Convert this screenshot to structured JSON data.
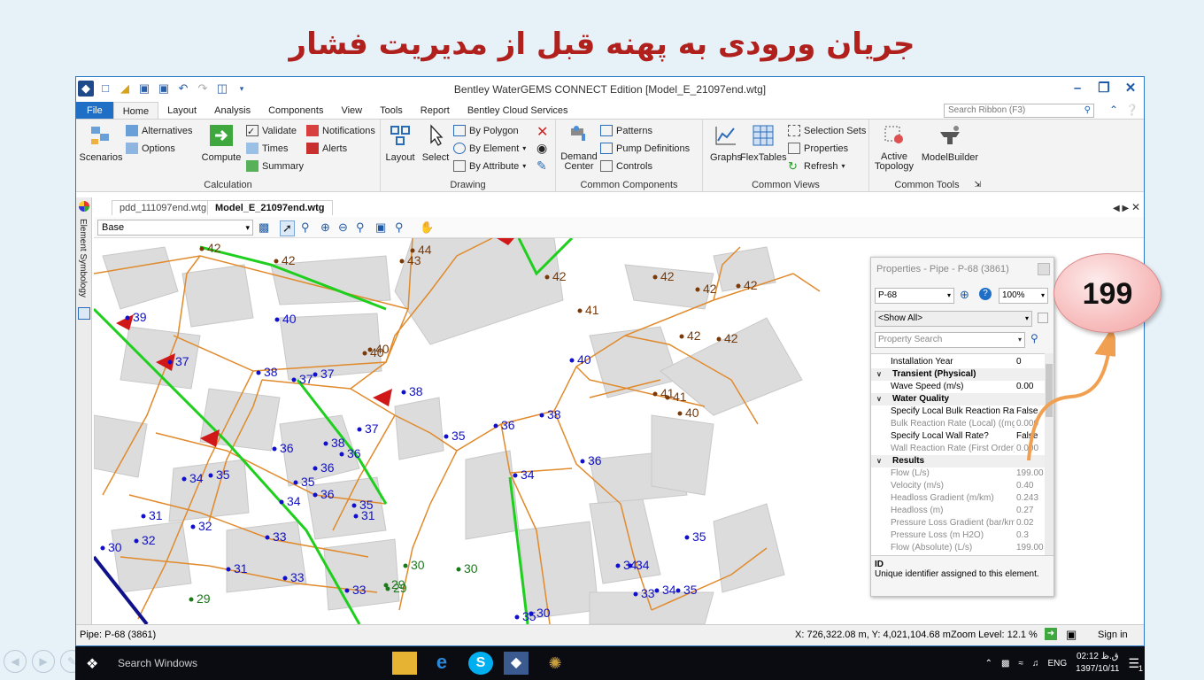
{
  "slide_title": "جریان ورودی به پهنه قبل از مدیریت فشار",
  "window": {
    "title": "Bentley WaterGEMS CONNECT Edition [Model_E_21097end.wtg]"
  },
  "ribbon_tabs": [
    "File",
    "Home",
    "Layout",
    "Analysis",
    "Components",
    "View",
    "Tools",
    "Report",
    "Bentley Cloud Services"
  ],
  "search_ribbon_placeholder": "Search Ribbon (F3)",
  "ribbon": {
    "calculation": {
      "label": "Calculation",
      "scenarios": "Scenarios",
      "alternatives": "Alternatives",
      "options": "Options",
      "compute": "Compute",
      "validate": "Validate",
      "times": "Times",
      "summary": "Summary",
      "notifications": "Notifications",
      "alerts": "Alerts"
    },
    "drawing": {
      "label": "Drawing",
      "layout": "Layout",
      "select": "Select",
      "by_polygon": "By Polygon",
      "by_element": "By Element",
      "by_attribute": "By Attribute"
    },
    "common_components": {
      "label": "Common Components",
      "demand_center": "Demand Center",
      "patterns": "Patterns",
      "pump_definitions": "Pump Definitions",
      "controls": "Controls"
    },
    "common_views": {
      "label": "Common Views",
      "graphs": "Graphs",
      "flextables": "FlexTables",
      "selection_sets": "Selection Sets",
      "properties": "Properties",
      "refresh": "Refresh"
    },
    "common_tools": {
      "label": "Common Tools",
      "active_topology": "Active Topology",
      "modelbuilder": "ModelBuilder"
    }
  },
  "doc_tabs": [
    "pdd_111097end.wtg",
    "Model_E_21097end.wtg"
  ],
  "side_panel_label": "Element Symbology",
  "layer_select": "Base",
  "map_labels": [
    {
      "t": "42",
      "c": "brown"
    },
    {
      "t": "44",
      "c": "brown"
    },
    {
      "t": "42",
      "c": "brown"
    },
    {
      "t": "43",
      "c": "brown"
    },
    {
      "t": "42",
      "c": "brown"
    },
    {
      "t": "42",
      "c": "brown"
    },
    {
      "t": "42",
      "c": "brown"
    },
    {
      "t": "42",
      "c": "brown"
    },
    {
      "t": "41",
      "c": "brown"
    },
    {
      "t": "42",
      "c": "brown"
    },
    {
      "t": "42",
      "c": "brown"
    },
    {
      "t": "40",
      "c": "brown"
    },
    {
      "t": "40",
      "c": "brown"
    },
    {
      "t": "41",
      "c": "brown"
    },
    {
      "t": "41",
      "c": "brown"
    },
    {
      "t": "40",
      "c": "brown"
    },
    {
      "t": "39",
      "c": "blue"
    },
    {
      "t": "40",
      "c": "blue"
    },
    {
      "t": "37",
      "c": "blue"
    },
    {
      "t": "38",
      "c": "blue"
    },
    {
      "t": "37",
      "c": "blue"
    },
    {
      "t": "37",
      "c": "blue"
    },
    {
      "t": "38",
      "c": "blue"
    },
    {
      "t": "40",
      "c": "blue"
    },
    {
      "t": "37",
      "c": "blue"
    },
    {
      "t": "38",
      "c": "blue"
    },
    {
      "t": "36",
      "c": "blue"
    },
    {
      "t": "35",
      "c": "blue"
    },
    {
      "t": "36",
      "c": "blue"
    },
    {
      "t": "38",
      "c": "blue"
    },
    {
      "t": "36",
      "c": "blue"
    },
    {
      "t": "36",
      "c": "blue"
    },
    {
      "t": "36",
      "c": "blue"
    },
    {
      "t": "36",
      "c": "blue"
    },
    {
      "t": "34",
      "c": "blue"
    },
    {
      "t": "35",
      "c": "blue"
    },
    {
      "t": "35",
      "c": "blue"
    },
    {
      "t": "34",
      "c": "blue"
    },
    {
      "t": "34",
      "c": "blue"
    },
    {
      "t": "34",
      "c": "blue"
    },
    {
      "t": "35",
      "c": "blue"
    },
    {
      "t": "31",
      "c": "blue"
    },
    {
      "t": "31",
      "c": "blue"
    },
    {
      "t": "32",
      "c": "blue"
    },
    {
      "t": "32",
      "c": "blue"
    },
    {
      "t": "30",
      "c": "blue"
    },
    {
      "t": "33",
      "c": "blue"
    },
    {
      "t": "31",
      "c": "blue"
    },
    {
      "t": "33",
      "c": "blue"
    },
    {
      "t": "33",
      "c": "blue"
    },
    {
      "t": "35",
      "c": "blue"
    },
    {
      "t": "34",
      "c": "blue"
    },
    {
      "t": "33",
      "c": "blue"
    },
    {
      "t": "34",
      "c": "blue"
    },
    {
      "t": "35",
      "c": "blue"
    },
    {
      "t": "35",
      "c": "blue"
    },
    {
      "t": "30",
      "c": "blue"
    },
    {
      "t": "30",
      "c": "green"
    },
    {
      "t": "30",
      "c": "green"
    },
    {
      "t": "29",
      "c": "green"
    },
    {
      "t": "29",
      "c": "green"
    },
    {
      "t": "29",
      "c": "green"
    }
  ],
  "properties": {
    "title": "Properties - Pipe - P-68 (3861)",
    "element": "P-68",
    "zoom": "100%",
    "filter": "<Show All>",
    "search_placeholder": "Property Search",
    "rows": [
      {
        "name": "Installation Year",
        "value": "0",
        "kind": "prop"
      },
      {
        "name": "Transient (Physical)",
        "value": "",
        "kind": "cat"
      },
      {
        "name": "Wave Speed (m/s)",
        "value": "0.00",
        "kind": "prop"
      },
      {
        "name": "Water Quality",
        "value": "",
        "kind": "cat"
      },
      {
        "name": "Specify Local Bulk Reaction Rate?",
        "value": "False",
        "kind": "prop"
      },
      {
        "name": "Bulk Reaction Rate (Local) ((mg/L)^(1-n)/day)",
        "value": "0.000",
        "kind": "ro"
      },
      {
        "name": "Specify Local Wall Rate?",
        "value": "False",
        "kind": "prop"
      },
      {
        "name": "Wall Reaction Rate (First Order) (m/day)",
        "value": "0.000",
        "kind": "ro"
      },
      {
        "name": "Results",
        "value": "",
        "kind": "cat"
      },
      {
        "name": "Flow (L/s)",
        "value": "199.00",
        "kind": "ro"
      },
      {
        "name": "Velocity (m/s)",
        "value": "0.40",
        "kind": "ro"
      },
      {
        "name": "Headloss Gradient (m/km)",
        "value": "0.243",
        "kind": "ro"
      },
      {
        "name": "Headloss (m)",
        "value": "0.27",
        "kind": "ro"
      },
      {
        "name": "Pressure Loss Gradient (bar/km)",
        "value": "0.02",
        "kind": "ro"
      },
      {
        "name": "Pressure Loss (m H2O)",
        "value": "0.3",
        "kind": "ro"
      },
      {
        "name": "Flow (Absolute) (L/s)",
        "value": "199.00",
        "kind": "ro"
      }
    ],
    "desc_title": "ID",
    "desc_text": "Unique identifier assigned to this element."
  },
  "callout": "199",
  "status": {
    "left": "Pipe: P-68 (3861)",
    "coords": "X: 726,322.08 m, Y: 4,021,104.68 m",
    "zoom": "Zoom Level: 12.1 %",
    "signin": "Sign in"
  },
  "taskbar": {
    "search": "Search Windows",
    "lang": "ENG",
    "time": "ق.ظ 02:12",
    "date": "1397/10/11",
    "notif_count": "1"
  },
  "colors": {
    "accent": "#1e6fc5",
    "slide_title": "#b0201c",
    "pipe_orange": "#e08a2c",
    "pipe_green": "#1ecf1e",
    "label_blue": "#1010cc",
    "label_brown": "#7a3a08",
    "label_green": "#1a7a1a"
  }
}
